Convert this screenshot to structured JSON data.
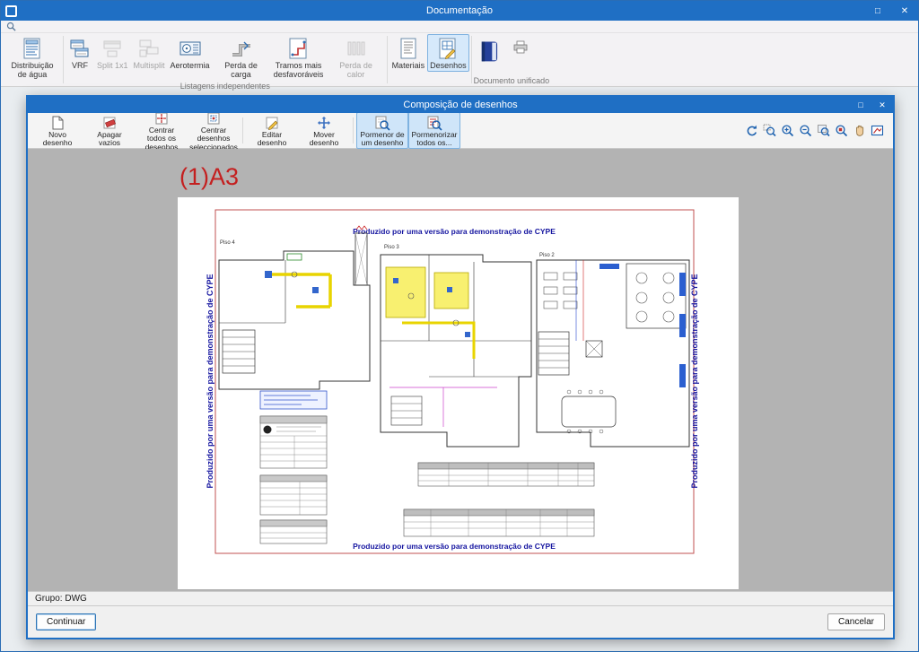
{
  "window": {
    "title": "Documentação"
  },
  "ribbon": {
    "buttons": [
      {
        "label": "Distribuição de água"
      },
      {
        "label": "VRF"
      },
      {
        "label": "Split 1x1"
      },
      {
        "label": "Multisplit"
      },
      {
        "label": "Aerotermia"
      },
      {
        "label": "Perda de carga"
      },
      {
        "label": "Tramos mais desfavoráveis"
      },
      {
        "label": "Perda de calor"
      },
      {
        "label": "Materiais"
      },
      {
        "label": "Desenhos"
      }
    ],
    "groups": {
      "listagens": "Listagens independentes",
      "documento": "Documento unificado"
    }
  },
  "dialog": {
    "title": "Composição de desenhos",
    "toolbar": [
      {
        "label": "Novo desenho"
      },
      {
        "label": "Apagar vazios"
      },
      {
        "label": "Centrar todos os desenhos"
      },
      {
        "label": "Centrar desenhos seleccionados"
      },
      {
        "label": "Editar desenho"
      },
      {
        "label": "Mover desenho"
      },
      {
        "label": "Pormenor de um desenho"
      },
      {
        "label": "Pormenorizar todos os..."
      }
    ],
    "status": "Grupo: DWG",
    "buttons": {
      "continue": "Continuar",
      "cancel": "Cancelar"
    }
  },
  "canvas": {
    "sheet_label": "(1)A3"
  },
  "drawing": {
    "watermark": "Produzido por uma versão para demonstração de CYPE",
    "floor_labels": [
      "Piso 4",
      "Piso 3",
      "Piso 2"
    ]
  }
}
